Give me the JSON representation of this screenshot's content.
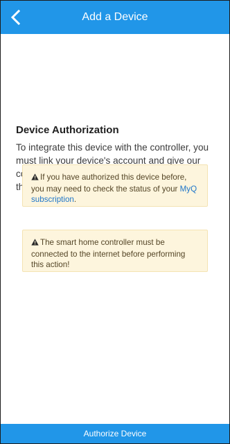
{
  "header": {
    "title": "Add a Device",
    "back_icon": "chevron-left-icon"
  },
  "main": {
    "heading": "Device Authorization",
    "description": "To integrate this device with the controller, you must link your device's account and give our controller access to the desired devices. Tap the button below to get started."
  },
  "alerts": [
    {
      "icon": "warning-icon",
      "text_before_link": "If you have authorized this device before, you may need to check the status of your ",
      "link_text": "MyQ subscription",
      "text_after_link": "."
    },
    {
      "icon": "warning-icon",
      "text": "The smart home controller must be connected to the internet before performing this action!"
    }
  ],
  "footer": {
    "button_label": "Authorize Device"
  },
  "colors": {
    "primary": "#2196e8",
    "alert_bg": "#fdf5dd",
    "link": "#1f76c9"
  }
}
